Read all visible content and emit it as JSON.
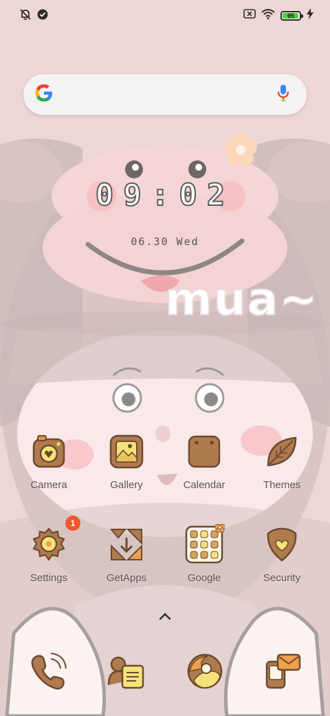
{
  "status_bar": {
    "left_icons": [
      "notifications-off-icon",
      "check-circle-icon"
    ],
    "right_icons": [
      "no-sim-icon",
      "wifi-icon",
      "battery-icon",
      "charging-bolt-icon"
    ],
    "battery_percent": "95"
  },
  "search": {
    "icons": [
      "google-logo-icon",
      "mic-icon"
    ]
  },
  "clock": {
    "time": "09:02",
    "date": "06.30 Wed"
  },
  "wallpaper": {
    "text": "mua~"
  },
  "apps": [
    {
      "label": "Camera",
      "icon": "camera-icon"
    },
    {
      "label": "Gallery",
      "icon": "gallery-icon"
    },
    {
      "label": "Calendar",
      "icon": "calendar-icon"
    },
    {
      "label": "Themes",
      "icon": "leaf-icon"
    },
    {
      "label": "Settings",
      "icon": "gear-icon",
      "badge": "1"
    },
    {
      "label": "GetApps",
      "icon": "getapps-icon"
    },
    {
      "label": "Google",
      "icon": "google-folder-icon"
    },
    {
      "label": "Security",
      "icon": "shield-heart-icon"
    }
  ],
  "dock": [
    {
      "icon": "phone-icon"
    },
    {
      "icon": "contacts-icon"
    },
    {
      "icon": "browser-icon"
    },
    {
      "icon": "messages-icon"
    }
  ],
  "colors": {
    "background": "#efd6d6",
    "icon_brown": "#a8784e",
    "icon_yellow": "#f5e27a",
    "badge": "#f2572b",
    "battery": "#4cd137"
  }
}
